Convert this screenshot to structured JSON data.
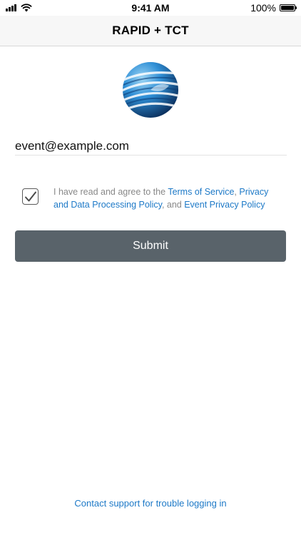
{
  "status_bar": {
    "time": "9:41 AM",
    "battery_percent": "100%",
    "battery_level": 1.0,
    "signal_icon": "signal-bars-icon",
    "wifi_icon": "wifi-icon",
    "battery_icon": "battery-icon"
  },
  "nav": {
    "title": "RAPID + TCT"
  },
  "logo": {
    "icon": "globe-logo-icon",
    "colors": {
      "primary": "#1c6fb9",
      "light": "#5fb5e8",
      "dark": "#0b2f5c"
    }
  },
  "form": {
    "email_value": "event@example.com",
    "agreement": {
      "checked": true,
      "prefix": "I have read and agree to the ",
      "terms_link": "Terms of Service",
      "sep1": ", ",
      "privacy_link": "Privacy and Data Processing Policy",
      "sep2": ", and ",
      "event_privacy_link": "Event Privacy Policy"
    },
    "submit_label": "Submit"
  },
  "footer": {
    "support_link": "Contact support for trouble logging in"
  },
  "colors": {
    "link": "#1d79c7",
    "button_bg": "#59636a",
    "nav_bg": "#f7f7f7"
  }
}
